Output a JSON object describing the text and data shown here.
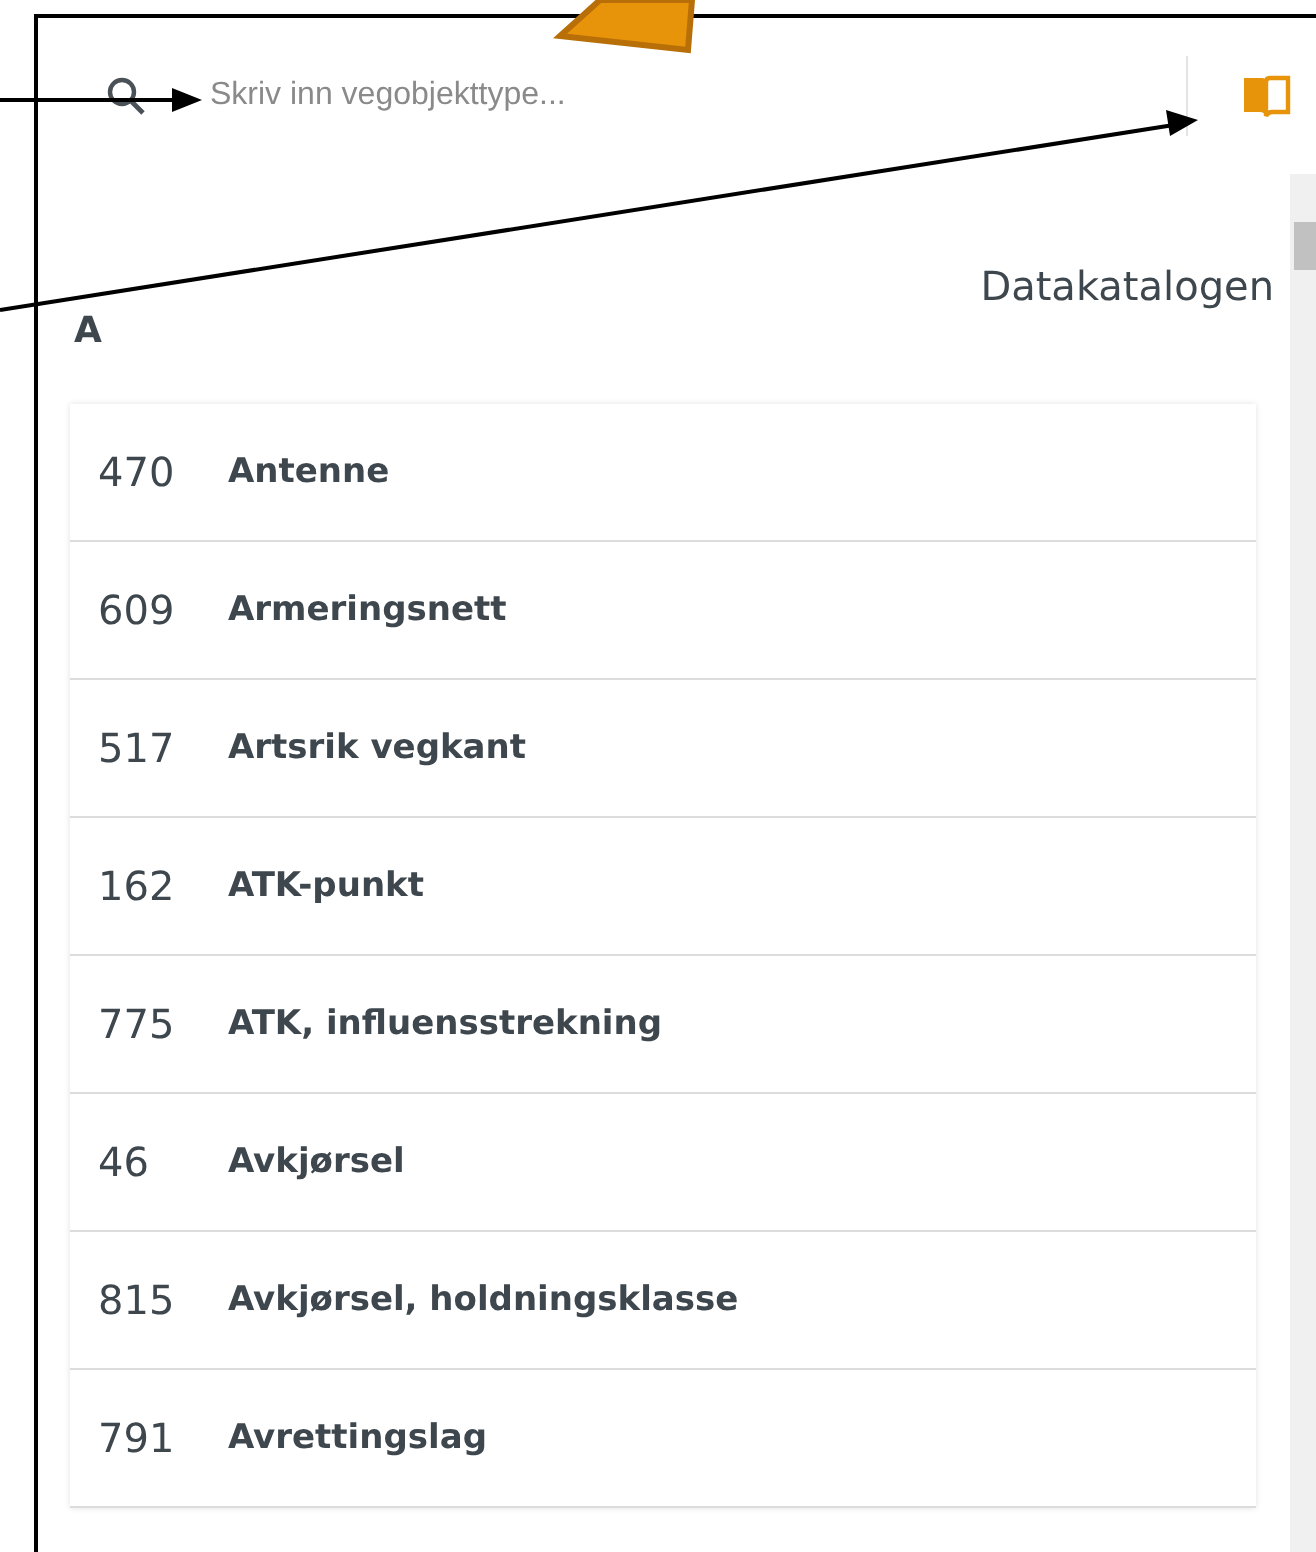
{
  "search": {
    "placeholder": "Skriv inn vegobjekttype..."
  },
  "catalog_link": "Datakatalogen",
  "section": {
    "letter": "A",
    "items": [
      {
        "code": "470",
        "name": "Antenne"
      },
      {
        "code": "609",
        "name": "Armeringsnett"
      },
      {
        "code": "517",
        "name": "Artsrik vegkant"
      },
      {
        "code": "162",
        "name": "ATK-punkt"
      },
      {
        "code": "775",
        "name": "ATK, influensstrekning"
      },
      {
        "code": "46",
        "name": "Avkjørsel"
      },
      {
        "code": "815",
        "name": "Avkjørsel, holdningsklasse"
      },
      {
        "code": "791",
        "name": "Avrettingslag"
      }
    ]
  }
}
